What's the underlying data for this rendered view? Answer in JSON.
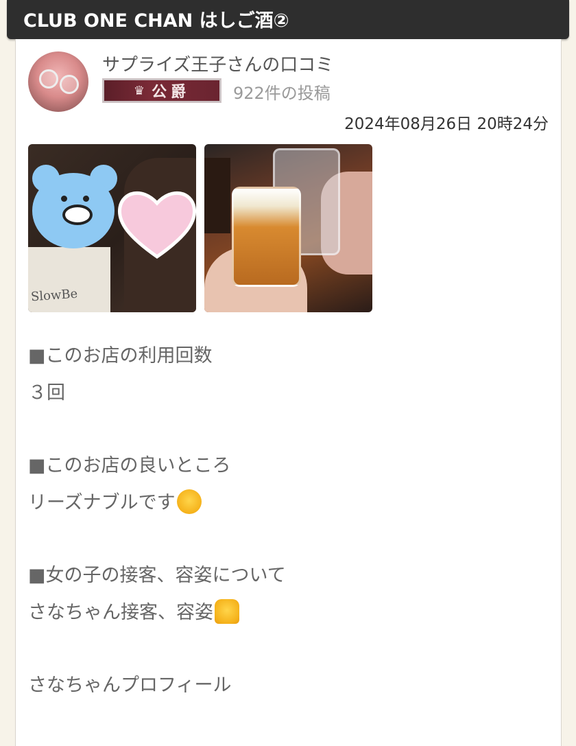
{
  "header": {
    "title": "CLUB ONE CHAN はしご酒②"
  },
  "review": {
    "reviewer_name": "サプライズ王子さんの口コミ",
    "rank_label": "公爵",
    "post_count": "922件の投稿",
    "date": "2024年08月26日 20時24分",
    "shirt_text": "SlowBe",
    "body": {
      "q1": "■このお店の利用回数",
      "a1": "３回",
      "q2": "■このお店の良いところ",
      "a2": "リーズナブルです",
      "q3": "■女の子の接客、容姿について",
      "a3": "さなちゃん接客、容姿",
      "profile": "さなちゃんプロフィール"
    }
  },
  "icons": {
    "rank_icon": "crown-icon",
    "emoji_hug": "hugging-face-icon",
    "emoji_thumb": "thumbs-up-icon"
  },
  "colors": {
    "title_bar": "#2e2e2e",
    "rank_badge": "#6a2430",
    "background": "#f7f3e9"
  }
}
